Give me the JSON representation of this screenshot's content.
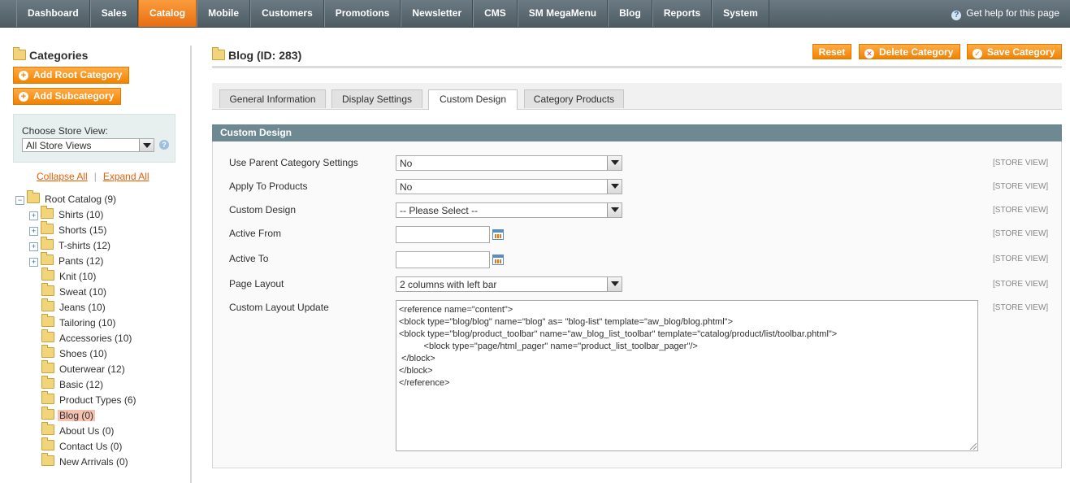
{
  "nav": {
    "items": [
      "Dashboard",
      "Sales",
      "Catalog",
      "Mobile",
      "Customers",
      "Promotions",
      "Newsletter",
      "CMS",
      "SM MegaMenu",
      "Blog",
      "Reports",
      "System"
    ],
    "active": "Catalog",
    "help": "Get help for this page"
  },
  "sidebar": {
    "title": "Categories",
    "add_root": "Add Root Category",
    "add_sub": "Add Subcategory",
    "store_label": "Choose Store View:",
    "store_value": "All Store Views",
    "collapse_all": "Collapse All",
    "expand_all": "Expand All",
    "separator": "|",
    "tree": [
      {
        "label": "Root Catalog (9)",
        "level": 0,
        "expander": "-"
      },
      {
        "label": "Shirts (10)",
        "level": 1,
        "expander": "+"
      },
      {
        "label": "Shorts (15)",
        "level": 1,
        "expander": "+"
      },
      {
        "label": "T-shirts (12)",
        "level": 1,
        "expander": "+"
      },
      {
        "label": "Pants (12)",
        "level": 1,
        "expander": "+"
      },
      {
        "label": "Knit (10)",
        "level": 1,
        "expander": ""
      },
      {
        "label": "Sweat (10)",
        "level": 1,
        "expander": ""
      },
      {
        "label": "Jeans (10)",
        "level": 1,
        "expander": ""
      },
      {
        "label": "Tailoring (10)",
        "level": 1,
        "expander": ""
      },
      {
        "label": "Accessories (10)",
        "level": 1,
        "expander": ""
      },
      {
        "label": "Shoes (10)",
        "level": 1,
        "expander": ""
      },
      {
        "label": "Outerwear (12)",
        "level": 1,
        "expander": ""
      },
      {
        "label": "Basic (12)",
        "level": 1,
        "expander": ""
      },
      {
        "label": "Product Types (6)",
        "level": 1,
        "expander": ""
      },
      {
        "label": "Blog (0)",
        "level": 1,
        "expander": "",
        "selected": true
      },
      {
        "label": "About Us (0)",
        "level": 1,
        "expander": ""
      },
      {
        "label": "Contact Us (0)",
        "level": 1,
        "expander": ""
      },
      {
        "label": "New Arrivals (0)",
        "level": 1,
        "expander": ""
      }
    ]
  },
  "main": {
    "title": "Blog (ID: 283)",
    "reset": "Reset",
    "delete": "Delete Category",
    "save": "Save Category",
    "tabs": [
      "General Information",
      "Display Settings",
      "Custom Design",
      "Category Products"
    ],
    "active_tab": "Custom Design",
    "section_title": "Custom Design",
    "scope_label": "[STORE VIEW]",
    "fields": {
      "use_parent": {
        "label": "Use Parent Category Settings",
        "value": "No"
      },
      "apply_products": {
        "label": "Apply To Products",
        "value": "No"
      },
      "custom_design": {
        "label": "Custom Design",
        "value": "-- Please Select --"
      },
      "active_from": {
        "label": "Active From",
        "value": ""
      },
      "active_to": {
        "label": "Active To",
        "value": ""
      },
      "page_layout": {
        "label": "Page Layout",
        "value": "2 columns with left bar"
      },
      "layout_update": {
        "label": "Custom Layout Update",
        "value": "<reference name=\"content\">\n<block type=\"blog/blog\" name=\"blog\" as= \"blog-list\" template=\"aw_blog/blog.phtml\">\n<block type=\"blog/product_toolbar\" name=\"aw_blog_list_toolbar\" template=\"catalog/product/list/toolbar.phtml\">\n          <block type=\"page/html_pager\" name=\"product_list_toolbar_pager\"/>\n </block>\n</block>\n</reference>"
      }
    }
  },
  "colors": {
    "accent": "#f18200",
    "nav_active": "#eb7b1f",
    "section_header": "#6f8992",
    "link": "#eb5e00"
  }
}
